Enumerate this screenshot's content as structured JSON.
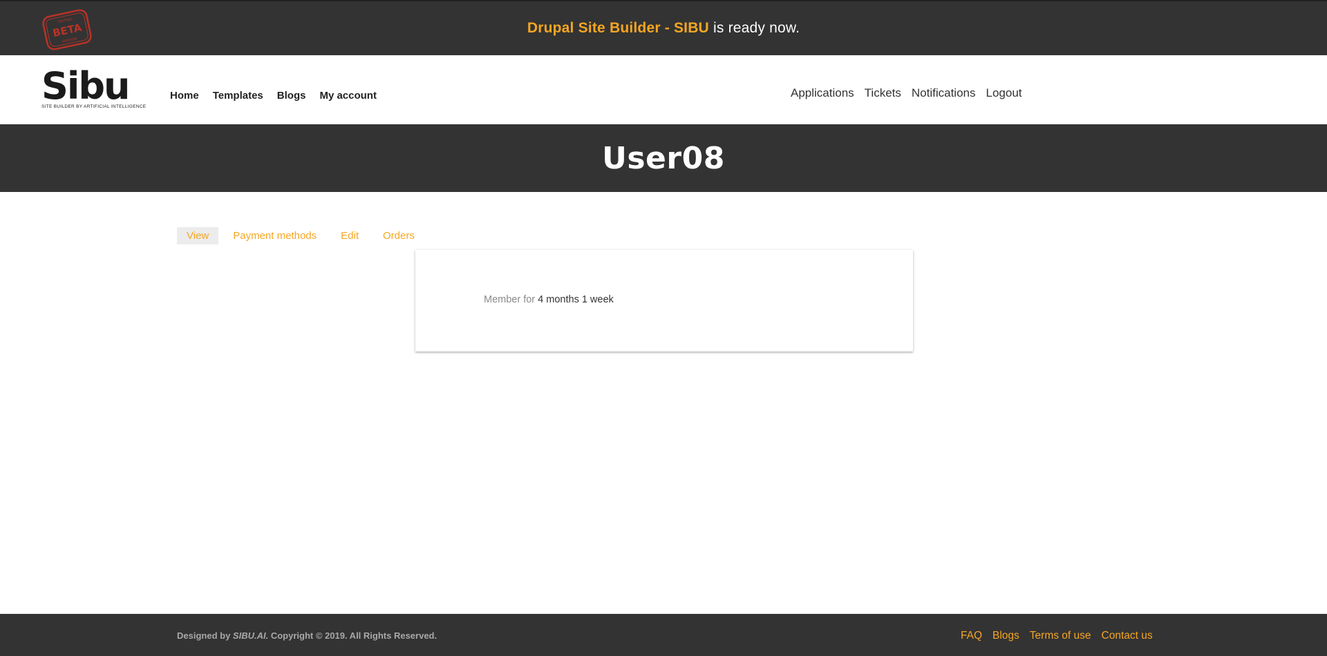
{
  "announcement": {
    "highlight": "Drupal Site Builder - SIBU",
    "rest": " is ready now."
  },
  "beta_stamp": {
    "top_text": "TESTING",
    "main_text": "BETA",
    "bottom_text": "VERSION"
  },
  "logo": {
    "word": "Sibu",
    "tagline": "SITE BUILDER BY ARTIFICIAL INTELLIGENCE"
  },
  "main_nav": {
    "home": "Home",
    "templates": "Templates",
    "blogs": "Blogs",
    "my_account": "My account"
  },
  "user_nav": {
    "applications": "Applications",
    "tickets": "Tickets",
    "notifications": "Notifications",
    "logout": "Logout"
  },
  "page_title": "User08",
  "tabs": {
    "view": "View",
    "payment_methods": "Payment methods",
    "edit": "Edit",
    "orders": "Orders"
  },
  "member": {
    "label": "Member for ",
    "value": "4 months 1 week"
  },
  "footer": {
    "designed_by": "Designed by ",
    "brand": "SIBU.AI.",
    "copyright": " Copyright © 2019. All Rights Reserved.",
    "links": {
      "faq": "FAQ",
      "blogs": "Blogs",
      "terms": "Terms of use",
      "contact": "Contact us"
    }
  },
  "colors": {
    "accent": "#f6a623",
    "dark_band": "#333333",
    "stamp_red": "#c0392b"
  },
  "icons": {
    "beta_stamp": "beta-stamp-icon",
    "logo_chip": "chip-icon"
  }
}
